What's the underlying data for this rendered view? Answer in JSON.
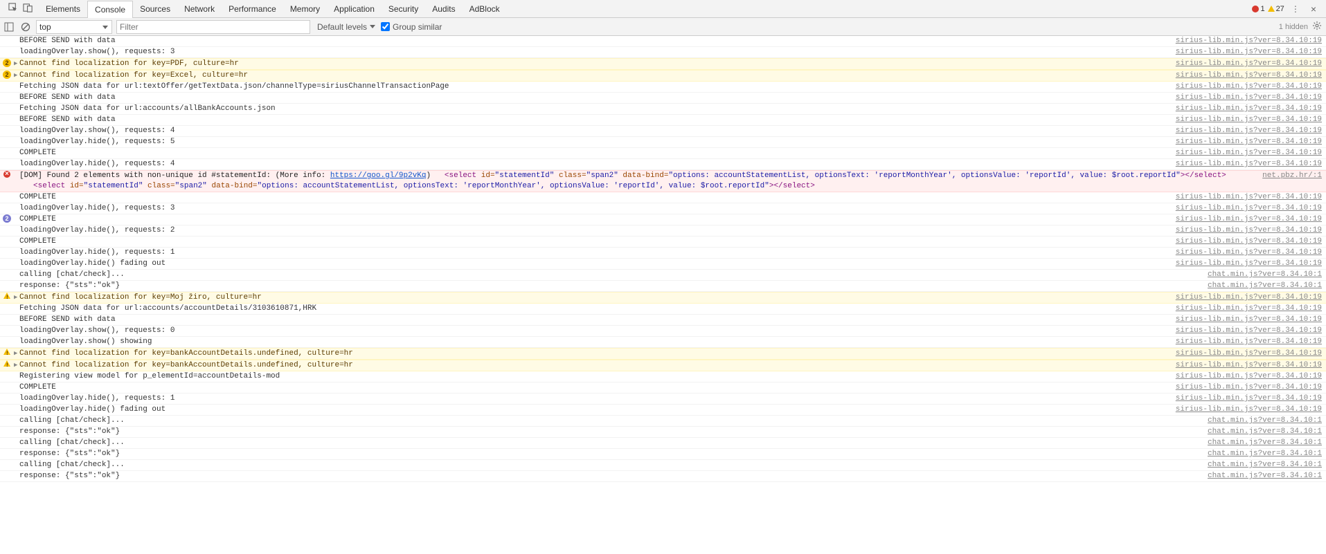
{
  "tabs": {
    "items": [
      "Elements",
      "Console",
      "Sources",
      "Network",
      "Performance",
      "Memory",
      "Application",
      "Security",
      "Audits",
      "AdBlock"
    ],
    "active": 1,
    "error_count": "1",
    "warn_count": "27"
  },
  "toolbar": {
    "context": "top",
    "filter_placeholder": "Filter",
    "levels": "Default levels",
    "group_similar": "Group similar",
    "hidden": "1 hidden"
  },
  "src_sirius": "sirius-lib.min.js?ver=8.34.10:19",
  "src_chat": "chat.min.js?ver=8.34.10:1",
  "src_net": "net.pbz.hr/:1",
  "dom_error": {
    "prefix": "[DOM] Found 2 elements with non-unique id #statementId: (More info: ",
    "link": "https://goo.gl/9p2vKq",
    "suffix": ")",
    "sel_open": "<select",
    "id_attr": " id=",
    "id_val": "\"statementId\"",
    "class_attr": " class=",
    "class_val": "\"span2\"",
    "bind_attr": " data-bind=",
    "bind_val": "\"options: accountStatementList, optionsText: 'reportMonthYear', optionsValue: 'reportId', value: $root.reportId\"",
    "close1": "></select>",
    "close2": "></select>"
  },
  "rows": [
    {
      "t": "log",
      "msg": "BEFORE SEND with data",
      "src": "sirius",
      "cut": true
    },
    {
      "t": "log",
      "msg": "loadingOverlay.show(), requests: 3",
      "src": "sirius"
    },
    {
      "t": "warn",
      "badge": "2",
      "arrow": true,
      "msg": "Cannot find localization for key=PDF, culture=hr",
      "src": "sirius"
    },
    {
      "t": "warn",
      "badge": "2",
      "arrow": true,
      "msg": "Cannot find localization for key=Excel, culture=hr",
      "src": "sirius"
    },
    {
      "t": "log",
      "msg": "Fetching JSON data for url:textOffer/getTextData.json/channelType=siriusChannelTransactionPage",
      "src": "sirius"
    },
    {
      "t": "log",
      "msg": "BEFORE SEND with data",
      "src": "sirius"
    },
    {
      "t": "log",
      "msg": "Fetching JSON data for url:accounts/allBankAccounts.json",
      "src": "sirius"
    },
    {
      "t": "log",
      "msg": "BEFORE SEND with data",
      "src": "sirius"
    },
    {
      "t": "log",
      "msg": "loadingOverlay.show(), requests: 4",
      "src": "sirius"
    },
    {
      "t": "log",
      "msg": "loadingOverlay.hide(), requests: 5",
      "src": "sirius"
    },
    {
      "t": "log",
      "msg": "COMPLETE",
      "src": "sirius"
    },
    {
      "t": "log",
      "msg": "loadingOverlay.hide(), requests: 4",
      "src": "sirius"
    },
    {
      "t": "domerror"
    },
    {
      "t": "log",
      "msg": "COMPLETE",
      "src": "sirius"
    },
    {
      "t": "log",
      "msg": "loadingOverlay.hide(), requests: 3",
      "src": "sirius"
    },
    {
      "t": "info",
      "badge": "2",
      "msg": "COMPLETE",
      "src": "sirius"
    },
    {
      "t": "log",
      "msg": "loadingOverlay.hide(), requests: 2",
      "src": "sirius"
    },
    {
      "t": "log",
      "msg": "COMPLETE",
      "src": "sirius"
    },
    {
      "t": "log",
      "msg": "loadingOverlay.hide(), requests: 1",
      "src": "sirius"
    },
    {
      "t": "log",
      "msg": "loadingOverlay.hide() fading out",
      "src": "sirius"
    },
    {
      "t": "log",
      "msg": "calling [chat/check]...",
      "src": "chat"
    },
    {
      "t": "log",
      "msg": "response: {\"sts\":\"ok\"}",
      "src": "chat"
    },
    {
      "t": "warn",
      "icon": true,
      "arrow": true,
      "msg": "Cannot find localization for key=Moj žiro, culture=hr",
      "src": "sirius"
    },
    {
      "t": "log",
      "msg": "Fetching JSON data for url:accounts/accountDetails/3103610871,HRK",
      "src": "sirius"
    },
    {
      "t": "log",
      "msg": "BEFORE SEND with data",
      "src": "sirius"
    },
    {
      "t": "log",
      "msg": "loadingOverlay.show(), requests: 0",
      "src": "sirius"
    },
    {
      "t": "log",
      "msg": "loadingOverlay.show() showing",
      "src": "sirius"
    },
    {
      "t": "warn",
      "icon": true,
      "arrow": true,
      "msg": "Cannot find localization for key=bankAccountDetails.undefined, culture=hr",
      "src": "sirius"
    },
    {
      "t": "warn",
      "icon": true,
      "arrow": true,
      "msg": "Cannot find localization for key=bankAccountDetails.undefined, culture=hr",
      "src": "sirius"
    },
    {
      "t": "log",
      "msg": "Registering view model for p_elementId=accountDetails-mod",
      "src": "sirius"
    },
    {
      "t": "log",
      "msg": "COMPLETE",
      "src": "sirius"
    },
    {
      "t": "log",
      "msg": "loadingOverlay.hide(), requests: 1",
      "src": "sirius"
    },
    {
      "t": "log",
      "msg": "loadingOverlay.hide() fading out",
      "src": "sirius"
    },
    {
      "t": "log",
      "msg": "calling [chat/check]...",
      "src": "chat"
    },
    {
      "t": "log",
      "msg": "response: {\"sts\":\"ok\"}",
      "src": "chat"
    },
    {
      "t": "log",
      "msg": "calling [chat/check]...",
      "src": "chat"
    },
    {
      "t": "log",
      "msg": "response: {\"sts\":\"ok\"}",
      "src": "chat"
    },
    {
      "t": "log",
      "msg": "calling [chat/check]...",
      "src": "chat"
    },
    {
      "t": "log",
      "msg": "response: {\"sts\":\"ok\"}",
      "src": "chat"
    }
  ]
}
